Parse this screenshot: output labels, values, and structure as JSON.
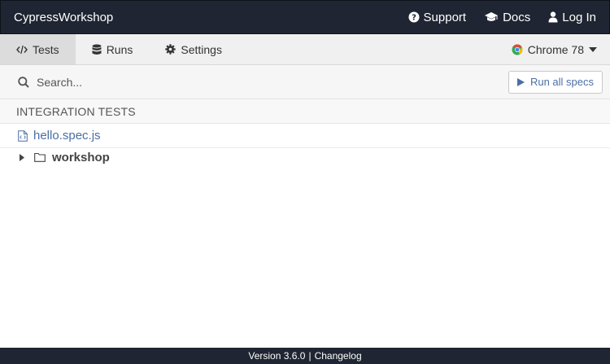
{
  "topbar": {
    "project_name": "CypressWorkshop",
    "links": [
      {
        "label": "Support",
        "icon": "question-circle-icon"
      },
      {
        "label": "Docs",
        "icon": "graduation-cap-icon"
      },
      {
        "label": "Log In",
        "icon": "user-icon"
      }
    ]
  },
  "tabs": [
    {
      "label": "Tests",
      "icon": "code-icon",
      "active": true
    },
    {
      "label": "Runs",
      "icon": "database-icon",
      "active": false
    },
    {
      "label": "Settings",
      "icon": "gear-icon",
      "active": false
    }
  ],
  "browser": {
    "label": "Chrome 78",
    "icon": "chrome-icon"
  },
  "search": {
    "placeholder": "Search...",
    "value": ""
  },
  "run_all": {
    "label": "Run all specs",
    "icon": "play-icon"
  },
  "specs": {
    "section_title": "INTEGRATION TESTS",
    "files": [
      {
        "name": "hello.spec.js",
        "icon": "file-code-icon"
      }
    ],
    "folders": [
      {
        "name": "workshop",
        "icon": "folder-icon",
        "expanded": false
      }
    ]
  },
  "footer": {
    "version": "Version 3.6.0",
    "separator": "|",
    "changelog": "Changelog"
  },
  "colors": {
    "topbar_bg": "#1f2532",
    "link_blue": "#4a6fa5",
    "chrome_green": "#34a853"
  }
}
